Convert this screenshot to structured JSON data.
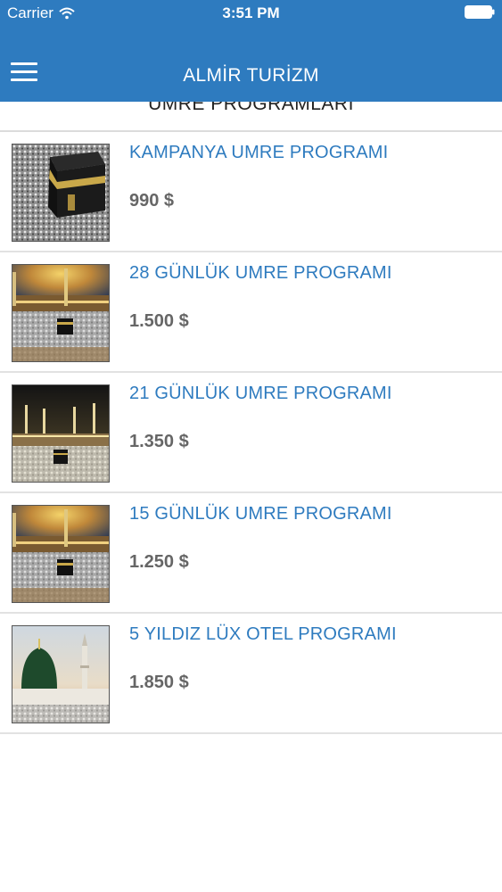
{
  "status_bar": {
    "carrier": "Carrier",
    "time": "3:51 PM",
    "wifi_icon": "wifi-icon",
    "battery_icon": "battery-icon"
  },
  "nav": {
    "title": "ALMİR TURİZM",
    "menu_icon": "hamburger-menu-icon",
    "background_color": "#2e7bbf"
  },
  "section": {
    "title": "UMRE PROGRAMLARI"
  },
  "programs": [
    {
      "name": "KAMPANYA UMRE PROGRAMI",
      "price": "990 $",
      "image": "kaaba-image"
    },
    {
      "name": "28 GÜNLÜK UMRE PROGRAMI",
      "price": "1.500 $",
      "image": "masjid-al-haram-image"
    },
    {
      "name": "21 GÜNLÜK UMRE PROGRAMI",
      "price": "1.350 $",
      "image": "masjid-al-haram-night-image"
    },
    {
      "name": "15 GÜNLÜK UMRE PROGRAMI",
      "price": "1.250 $",
      "image": "masjid-al-haram-image"
    },
    {
      "name": "5 YILDIZ LÜX OTEL PROGRAMI",
      "price": "1.850 $",
      "image": "green-dome-mosque-image"
    }
  ],
  "colors": {
    "accent": "#2e7bbf",
    "price": "#666666"
  }
}
